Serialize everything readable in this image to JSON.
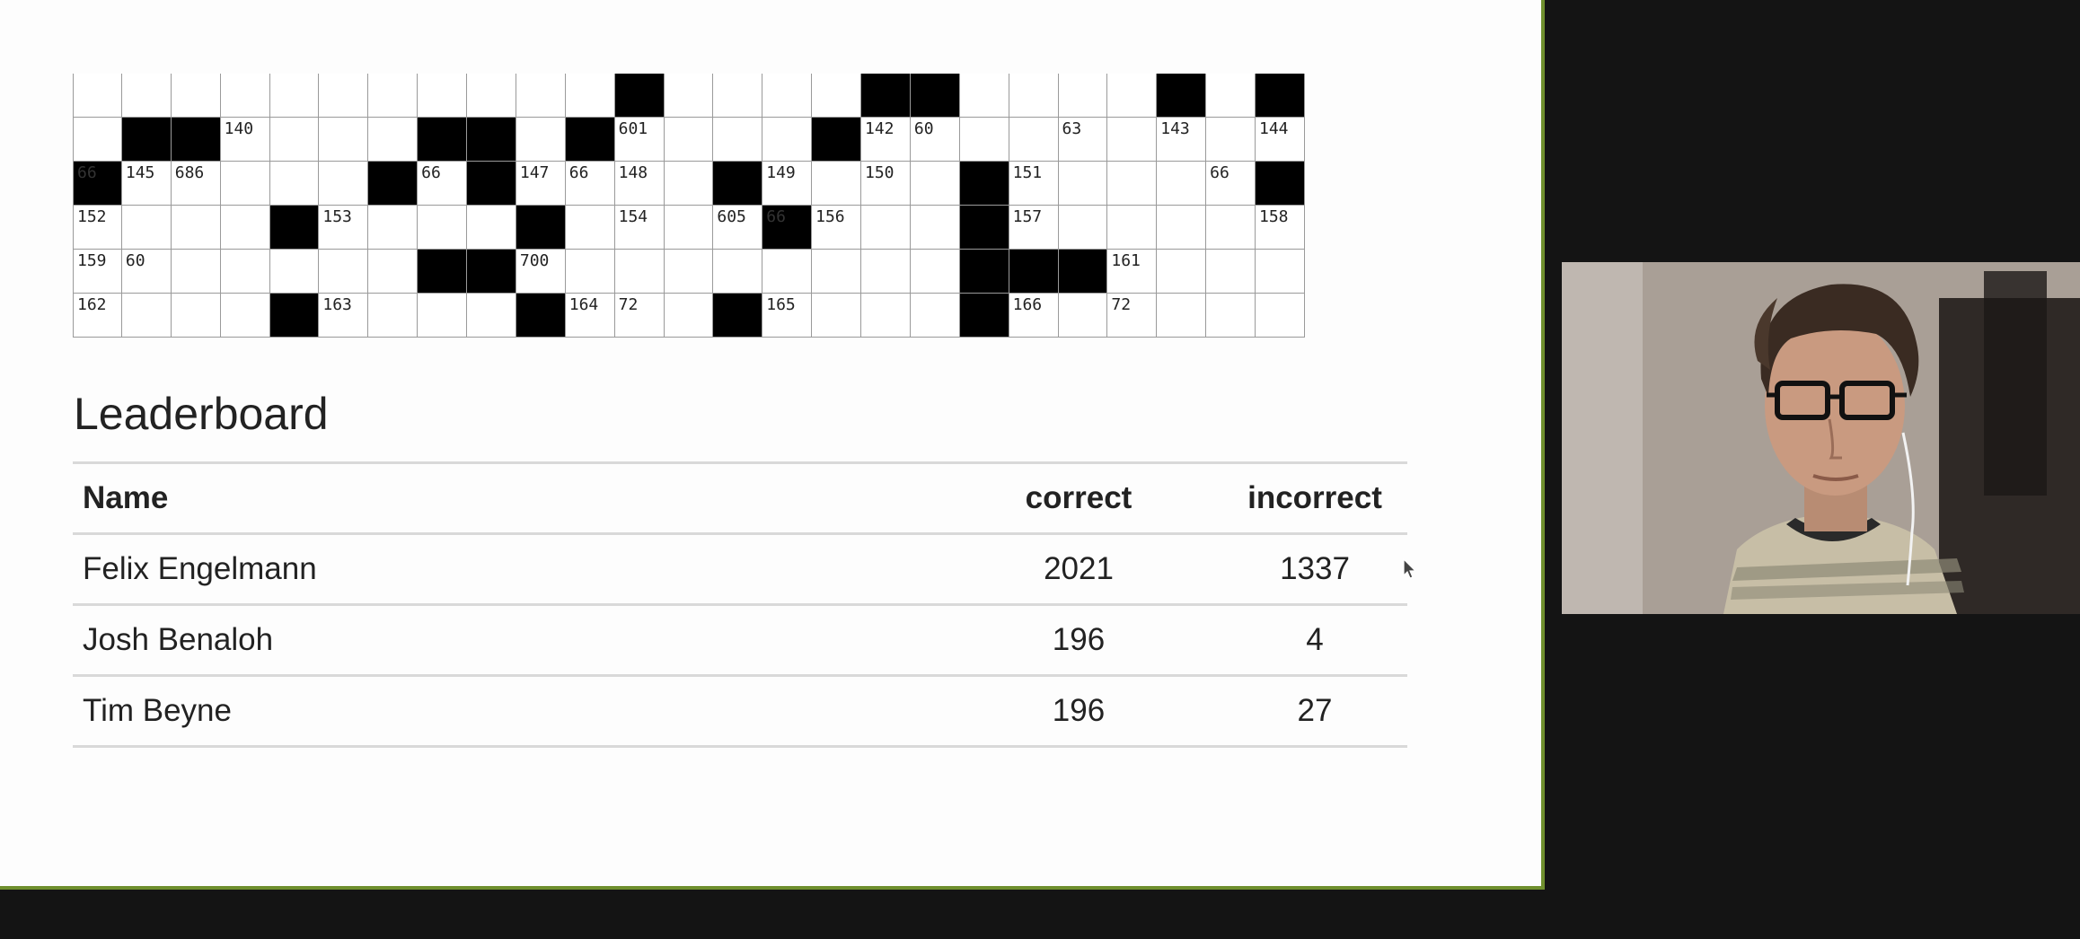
{
  "crossword": {
    "rows": [
      {
        "cells": [
          {
            "b": 0
          },
          {
            "b": 0
          },
          {
            "b": 0
          },
          {
            "b": 0
          },
          {
            "b": 0
          },
          {
            "b": 0
          },
          {
            "b": 0
          },
          {
            "b": 0
          },
          {
            "b": 0
          },
          {
            "b": 0
          },
          {
            "b": 0
          },
          {
            "b": 1
          },
          {
            "b": 0
          },
          {
            "b": 0
          },
          {
            "b": 0
          },
          {
            "b": 0
          },
          {
            "b": 1
          },
          {
            "b": 1
          },
          {
            "b": 0
          },
          {
            "b": 0
          },
          {
            "b": 0
          },
          {
            "b": 0
          },
          {
            "b": 1
          },
          {
            "b": 0
          },
          {
            "b": 1
          }
        ]
      },
      {
        "cells": [
          {
            "b": 0
          },
          {
            "b": 1
          },
          {
            "b": 1
          },
          {
            "b": 0,
            "n": "140"
          },
          {
            "b": 0
          },
          {
            "b": 0
          },
          {
            "b": 0
          },
          {
            "b": 1
          },
          {
            "b": 1
          },
          {
            "b": 0
          },
          {
            "b": 1
          },
          {
            "b": 0,
            "n": "601"
          },
          {
            "b": 0
          },
          {
            "b": 0
          },
          {
            "b": 0
          },
          {
            "b": 1
          },
          {
            "b": 0,
            "n": "142"
          },
          {
            "b": 0,
            "n": "60"
          },
          {
            "b": 0
          },
          {
            "b": 0
          },
          {
            "b": 0,
            "n": "63"
          },
          {
            "b": 0
          },
          {
            "b": 0,
            "n": "143"
          },
          {
            "b": 0
          },
          {
            "b": 0,
            "n": "144"
          }
        ]
      },
      {
        "cells": [
          {
            "b": 1,
            "n": "66"
          },
          {
            "b": 0,
            "n": "145"
          },
          {
            "b": 0,
            "n": "686"
          },
          {
            "b": 0
          },
          {
            "b": 0
          },
          {
            "b": 0
          },
          {
            "b": 1
          },
          {
            "b": 0,
            "n": "66"
          },
          {
            "b": 1
          },
          {
            "b": 0,
            "n": "147"
          },
          {
            "b": 0,
            "n": "66"
          },
          {
            "b": 0,
            "n": "148"
          },
          {
            "b": 0
          },
          {
            "b": 1
          },
          {
            "b": 0,
            "n": "149"
          },
          {
            "b": 0
          },
          {
            "b": 0,
            "n": "150"
          },
          {
            "b": 0
          },
          {
            "b": 1
          },
          {
            "b": 0,
            "n": "151"
          },
          {
            "b": 0
          },
          {
            "b": 0
          },
          {
            "b": 0
          },
          {
            "b": 0,
            "n": "66"
          },
          {
            "b": 1
          }
        ]
      },
      {
        "cells": [
          {
            "b": 0,
            "n": "152"
          },
          {
            "b": 0
          },
          {
            "b": 0
          },
          {
            "b": 0
          },
          {
            "b": 1
          },
          {
            "b": 0,
            "n": "153"
          },
          {
            "b": 0
          },
          {
            "b": 0
          },
          {
            "b": 0
          },
          {
            "b": 1
          },
          {
            "b": 0
          },
          {
            "b": 0,
            "n": "154"
          },
          {
            "b": 0
          },
          {
            "b": 0,
            "n": "605"
          },
          {
            "b": 1,
            "n": "66"
          },
          {
            "b": 0,
            "n": "156"
          },
          {
            "b": 0
          },
          {
            "b": 0
          },
          {
            "b": 1
          },
          {
            "b": 0,
            "n": "157"
          },
          {
            "b": 0
          },
          {
            "b": 0
          },
          {
            "b": 0
          },
          {
            "b": 0
          },
          {
            "b": 0,
            "n": "158"
          }
        ]
      },
      {
        "cells": [
          {
            "b": 0,
            "n": "159"
          },
          {
            "b": 0,
            "n": "60"
          },
          {
            "b": 0
          },
          {
            "b": 0
          },
          {
            "b": 0
          },
          {
            "b": 0
          },
          {
            "b": 0
          },
          {
            "b": 1
          },
          {
            "b": 1
          },
          {
            "b": 0,
            "n": "700"
          },
          {
            "b": 0
          },
          {
            "b": 0
          },
          {
            "b": 0
          },
          {
            "b": 0
          },
          {
            "b": 0
          },
          {
            "b": 0
          },
          {
            "b": 0
          },
          {
            "b": 0
          },
          {
            "b": 1
          },
          {
            "b": 1
          },
          {
            "b": 1
          },
          {
            "b": 0,
            "n": "161"
          },
          {
            "b": 0
          },
          {
            "b": 0
          },
          {
            "b": 0
          }
        ]
      },
      {
        "cells": [
          {
            "b": 0,
            "n": "162"
          },
          {
            "b": 0
          },
          {
            "b": 0
          },
          {
            "b": 0
          },
          {
            "b": 1
          },
          {
            "b": 0,
            "n": "163"
          },
          {
            "b": 0
          },
          {
            "b": 0
          },
          {
            "b": 0
          },
          {
            "b": 1
          },
          {
            "b": 0,
            "n": "164"
          },
          {
            "b": 0,
            "n": "72"
          },
          {
            "b": 0
          },
          {
            "b": 1
          },
          {
            "b": 0,
            "n": "165"
          },
          {
            "b": 0
          },
          {
            "b": 0
          },
          {
            "b": 0
          },
          {
            "b": 1
          },
          {
            "b": 0,
            "n": "166"
          },
          {
            "b": 0
          },
          {
            "b": 0,
            "n": "72"
          },
          {
            "b": 0
          },
          {
            "b": 0
          },
          {
            "b": 0
          }
        ]
      }
    ]
  },
  "leaderboard": {
    "title": "Leaderboard",
    "columns": {
      "name": "Name",
      "correct": "correct",
      "incorrect": "incorrect"
    },
    "rows": [
      {
        "name": "Felix Engelmann",
        "correct": "2021",
        "incorrect": "1337"
      },
      {
        "name": "Josh Benaloh",
        "correct": "196",
        "incorrect": "4"
      },
      {
        "name": "Tim Beyne",
        "correct": "196",
        "incorrect": "27"
      }
    ]
  },
  "colors": {
    "slide_bg": "#fdfdfd",
    "outer_bg": "#141414",
    "slide_border": "#6f8f2e",
    "text": "#222222",
    "rule": "#d9d9d9"
  },
  "icons": {
    "cursor": "mouse-pointer-icon"
  }
}
